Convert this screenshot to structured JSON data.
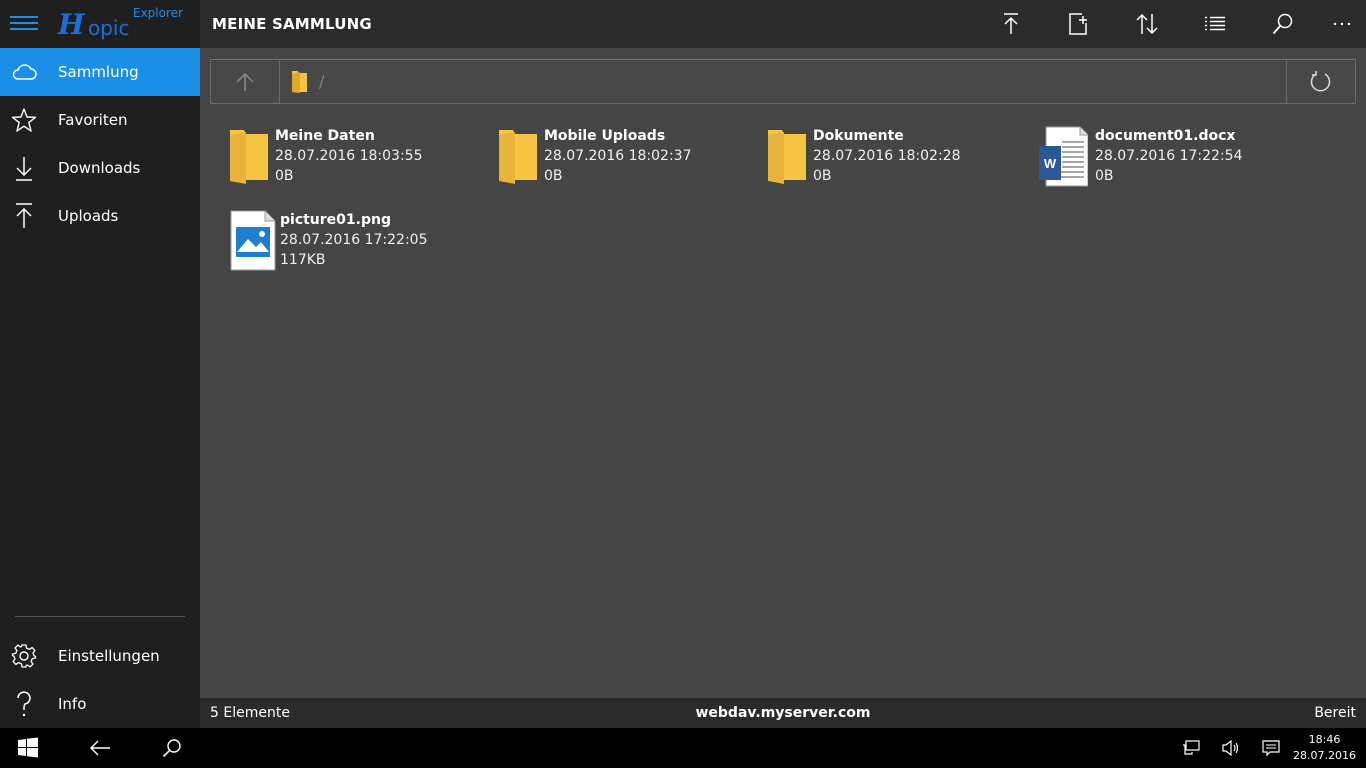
{
  "app": {
    "logo_letter": "H",
    "logo_text": "opic",
    "logo_sub": "Explorer"
  },
  "colors": {
    "accent": "#1b8fe6",
    "sidebar_bg": "#1f1f1f",
    "header_bg": "#2b2b2b",
    "content_bg": "#454545",
    "folder": "#f5c542"
  },
  "sidebar": {
    "items": [
      {
        "label": "Sammlung",
        "icon": "cloud-icon",
        "active": true
      },
      {
        "label": "Favoriten",
        "icon": "star-icon"
      },
      {
        "label": "Downloads",
        "icon": "download-icon"
      },
      {
        "label": "Uploads",
        "icon": "upload-icon"
      }
    ],
    "bottom_items": [
      {
        "label": "Einstellungen",
        "icon": "gear-icon"
      },
      {
        "label": "Info",
        "icon": "question-icon"
      }
    ]
  },
  "header": {
    "title": "MEINE SAMMLUNG",
    "actions": [
      "upload-icon",
      "new-folder-icon",
      "sort-icon",
      "list-view-icon",
      "search-icon",
      "more-icon"
    ]
  },
  "address": {
    "path_separator": "/"
  },
  "files": [
    {
      "name": "Meine Daten",
      "date": "28.07.2016 18:03:55",
      "size": "0B",
      "type": "folder"
    },
    {
      "name": "Mobile Uploads",
      "date": "28.07.2016 18:02:37",
      "size": "0B",
      "type": "folder"
    },
    {
      "name": "Dokumente",
      "date": "28.07.2016 18:02:28",
      "size": "0B",
      "type": "folder"
    },
    {
      "name": "document01.docx",
      "date": "28.07.2016 17:22:54",
      "size": "0B",
      "type": "word",
      "badge": "W"
    },
    {
      "name": "picture01.png",
      "date": "28.07.2016 17:22:05",
      "size": "117KB",
      "type": "image"
    }
  ],
  "status": {
    "count": "5 Elemente",
    "server": "webdav.myserver.com",
    "state": "Bereit"
  },
  "taskbar": {
    "time": "18:46",
    "date": "28.07.2016"
  }
}
